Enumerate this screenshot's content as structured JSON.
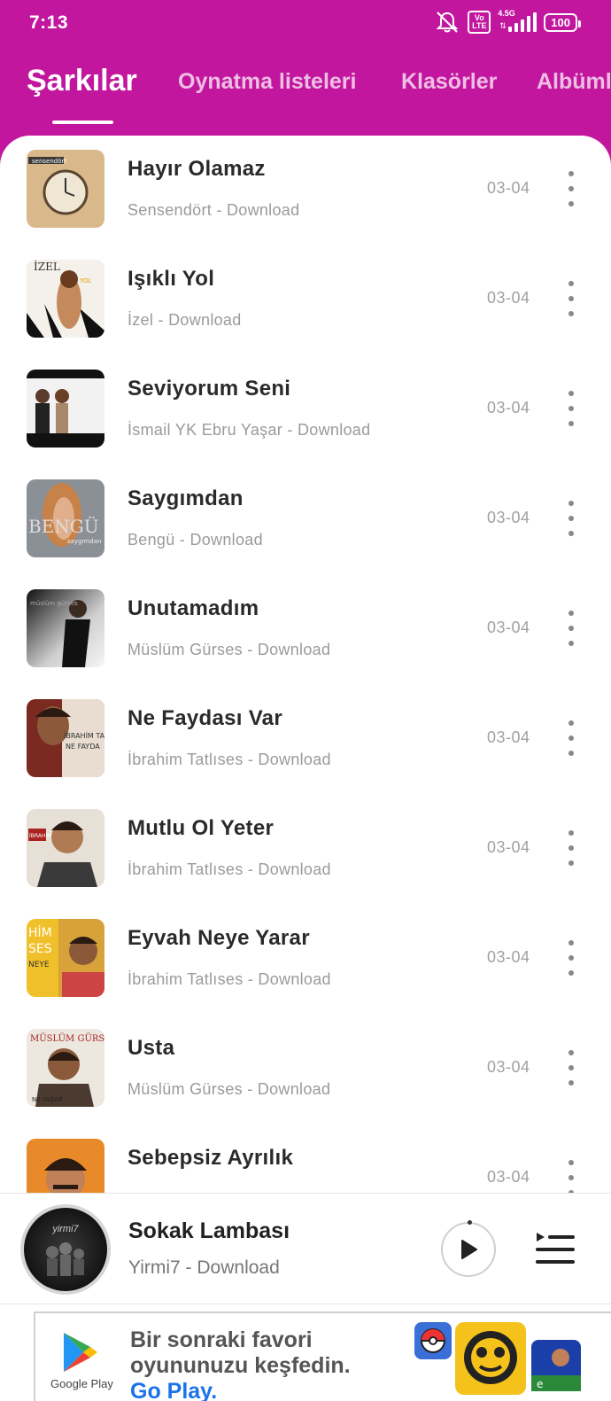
{
  "status_bar": {
    "time": "7:13",
    "volte": "Vo LTE",
    "network": "4.5G",
    "battery": "100"
  },
  "tabs": [
    {
      "label": "Şarkılar",
      "active": true
    },
    {
      "label": "Oynatma listeleri",
      "active": false
    },
    {
      "label": "Klasörler",
      "active": false
    },
    {
      "label": "Albümle",
      "active": false
    }
  ],
  "songs": [
    {
      "title": "Hayır Olamaz",
      "subtitle": "Sensendört - Download",
      "date": "03-04"
    },
    {
      "title": "Işıklı Yol",
      "subtitle": "İzel - Download",
      "date": "03-04"
    },
    {
      "title": "Seviyorum Seni",
      "subtitle": "İsmail YK Ebru Yaşar - Download",
      "date": "03-04"
    },
    {
      "title": "Saygımdan",
      "subtitle": "Bengü - Download",
      "date": "03-04"
    },
    {
      "title": "Unutamadım",
      "subtitle": "Müslüm Gürses - Download",
      "date": "03-04"
    },
    {
      "title": "Ne Faydası Var",
      "subtitle": "İbrahim Tatlıses - Download",
      "date": "03-04"
    },
    {
      "title": "Mutlu Ol Yeter",
      "subtitle": "İbrahim Tatlıses - Download",
      "date": "03-04"
    },
    {
      "title": "Eyvah Neye Yarar",
      "subtitle": "İbrahim Tatlıses - Download",
      "date": "03-04"
    },
    {
      "title": "Usta",
      "subtitle": "Müslüm Gürses - Download",
      "date": "03-04"
    },
    {
      "title": "Sebepsiz Ayrılık",
      "subtitle": "",
      "date": "03-04"
    }
  ],
  "now_playing": {
    "title": "Sokak Lambası",
    "subtitle": "Yirmi7 - Download",
    "cover_text": "yirmi7"
  },
  "ad": {
    "brand": "Google Play",
    "headline": "Bir sonraki favori oyununuzu keşfedin.",
    "cta": "Go Play."
  },
  "colors": {
    "accent": "#c2169e",
    "background": "#ffffff"
  }
}
